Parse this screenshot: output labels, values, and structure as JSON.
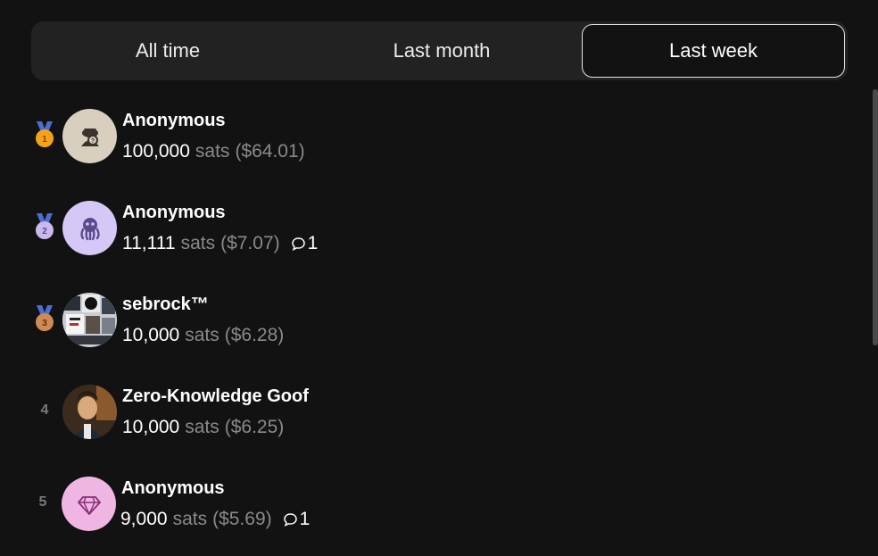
{
  "tabs": [
    {
      "label": "All time",
      "active": false
    },
    {
      "label": "Last month",
      "active": false
    },
    {
      "label": "Last week",
      "active": true
    }
  ],
  "leaderboard": [
    {
      "rank": "1",
      "medal": "gold-medal-icon",
      "avatar": "anonymous-hat-avatar",
      "avatar_bg": "#d8cfbf",
      "name": "Anonymous",
      "amount": "100,000",
      "unit": "sats",
      "usd": "($64.01)",
      "comments": ""
    },
    {
      "rank": "2",
      "medal": "silver-medal-icon",
      "avatar": "octopus-avatar",
      "avatar_bg": "#d6c8f6",
      "name": "Anonymous",
      "amount": "11,111",
      "unit": "sats",
      "usd": "($7.07)",
      "comments": "1"
    },
    {
      "rank": "3",
      "medal": "bronze-medal-icon",
      "avatar": "photo-collage-avatar",
      "avatar_bg": "#9aa2ad",
      "name": "sebrock™",
      "amount": "10,000",
      "unit": "sats",
      "usd": "($6.28)",
      "comments": ""
    },
    {
      "rank": "4",
      "medal": "",
      "avatar": "person-photo-avatar",
      "avatar_bg": "#6b4a30",
      "name": "Zero-Knowledge Goof",
      "amount": "10,000",
      "unit": "sats",
      "usd": "($6.25)",
      "comments": ""
    },
    {
      "rank": "5",
      "medal": "",
      "avatar": "diamond-avatar",
      "avatar_bg": "#f0b6e3",
      "name": "Anonymous",
      "amount": "9,000",
      "unit": "sats",
      "usd": "($5.69)",
      "comments": "1"
    }
  ],
  "colors": {
    "background": "#121212",
    "tab_bar": "#222222",
    "muted_text": "#8a8a8a",
    "gold": "#f4a21a",
    "silver": "#cbb8ee",
    "bronze": "#d28a55",
    "ribbon": "#4a6fd1"
  }
}
